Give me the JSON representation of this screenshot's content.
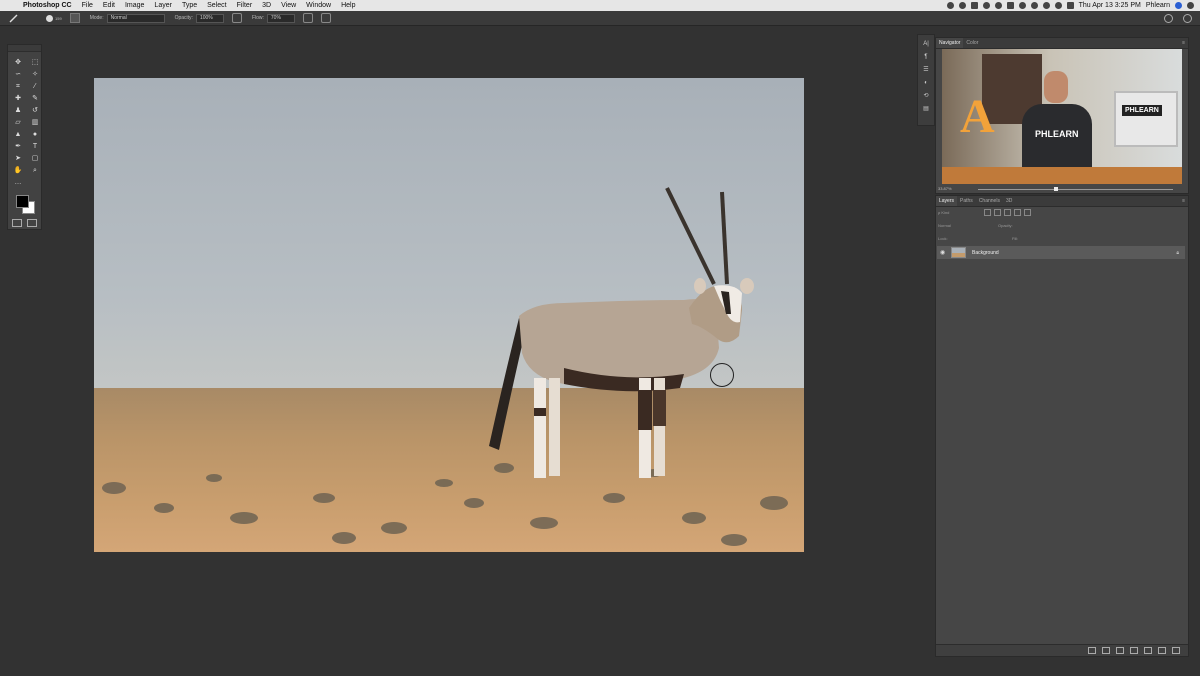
{
  "menubar": {
    "app_name": "Photoshop CC",
    "items": [
      "File",
      "Edit",
      "Image",
      "Layer",
      "Type",
      "Select",
      "Filter",
      "3D",
      "View",
      "Window",
      "Help"
    ],
    "clock": "Thu Apr 13  3:25 PM",
    "user": "Phlearn"
  },
  "options": {
    "brush_size": "159",
    "mode_label": "Mode:",
    "mode_value": "Normal",
    "opacity_label": "Opacity:",
    "opacity_value": "100%",
    "flow_label": "Flow:",
    "flow_value": "70%"
  },
  "navigator": {
    "tabs": [
      "Navigator",
      "Color"
    ],
    "zoom": "33.87%",
    "thumb_letter": "A",
    "shirt_text": "PHLEARN",
    "monitor_text": "PHLEARN"
  },
  "layers": {
    "tabs": [
      "Layers",
      "Paths",
      "Channels",
      "3D"
    ],
    "kind_label": "ρ Kind",
    "blend_mode": "Normal",
    "opacity_label": "Opacity:",
    "lock_label": "Lock:",
    "fill_label": "Fill:",
    "rows": [
      {
        "name": "Background",
        "visible": true,
        "locked": true
      }
    ]
  },
  "colors": {
    "foreground": "#000000",
    "background": "#ffffff",
    "workspace": "#323232"
  }
}
